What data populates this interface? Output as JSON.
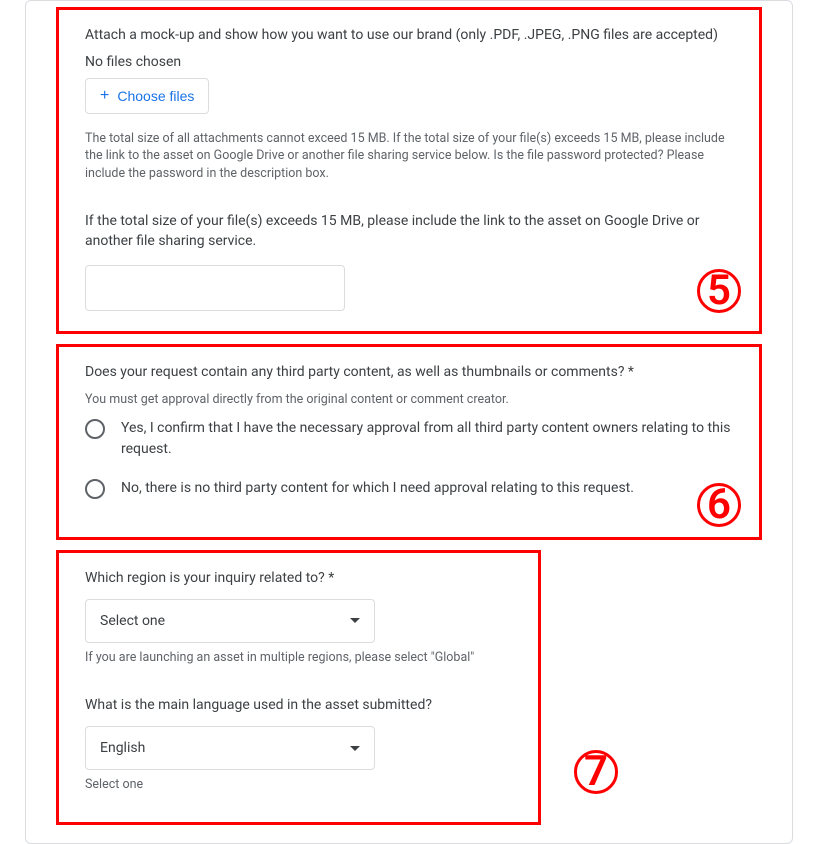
{
  "section5": {
    "question": "Attach a mock-up and show how you want to use our brand (only .PDF, .JPEG, .PNG files are accepted)",
    "no_files": "No files chosen",
    "choose_label": "Choose files",
    "helper": "The total size of all attachments cannot exceed 15 MB. If the total size of your file(s) exceeds 15 MB, please include the link to the asset on Google Drive or another file sharing service below. Is the file password protected? Please include the password in the description box.",
    "link_question": "If the total size of your file(s) exceeds 15 MB, please include the link to the asset on Google Drive or another file sharing service.",
    "annot": "5"
  },
  "section6": {
    "question": "Does your request contain any third party content, as well as thumbnails or comments? *",
    "helper": "You must get approval directly from the original content or comment creator.",
    "option_yes": "Yes, I confirm that I have the necessary approval from all third party content owners relating to this request.",
    "option_no": "No, there is no third party content for which I need approval relating to this request.",
    "annot": "6"
  },
  "section7": {
    "region_question": "Which region is your inquiry related to? *",
    "region_value": "Select one",
    "region_helper": "If you are launching an asset in multiple regions, please select \"Global\"",
    "lang_question": "What is the main language used in the asset submitted?",
    "lang_value": "English",
    "lang_helper": "Select one",
    "annot": "7"
  }
}
